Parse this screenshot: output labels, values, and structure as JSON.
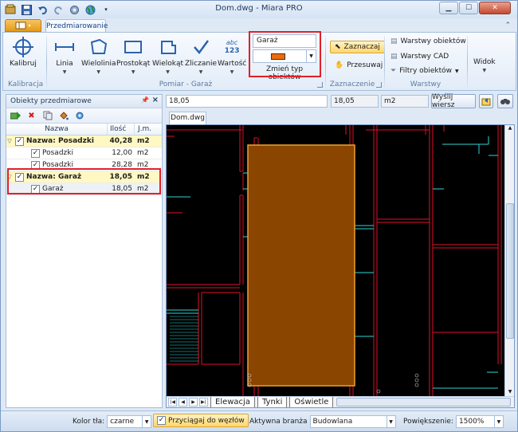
{
  "window": {
    "title": "Dom.dwg - Miara PRO",
    "controls": [
      "minimize",
      "maximize",
      "close"
    ]
  },
  "ribbon_tabs": {
    "active": "Przedmiarowanie"
  },
  "ribbon": {
    "kalibracja": {
      "button": "Kalibruj",
      "group": "Kalibracja"
    },
    "pomiar": {
      "buttons": [
        "Linia",
        "Wielolinia",
        "Prostokąt",
        "Wielokąt",
        "Zliczanie",
        "Wartość"
      ],
      "group": "Pomiar - Garaż",
      "value_icon_text": [
        "abc",
        "123"
      ]
    },
    "object_type": {
      "name": "Garaż",
      "color": "#f06a0c",
      "caption": "Zmień typ obiektów"
    },
    "zaznaczenie": {
      "select": "Zaznaczaj",
      "move": "Przesuwaj",
      "group": "Zaznaczenie"
    },
    "warstwy": {
      "items": [
        "Warstwy obiektów",
        "Warstwy CAD",
        "Filtry obiektów"
      ],
      "group": "Warstwy"
    },
    "widok": {
      "button": "Widok"
    }
  },
  "panel": {
    "title": "Obiekty przedmiarowe",
    "columns": [
      "Nazwa",
      "Ilość",
      "J.m."
    ],
    "groups": [
      {
        "name": "Nazwa: Posadzki",
        "qty": "40,28",
        "unit": "m2",
        "items": [
          {
            "name": "Posadzki",
            "qty": "12,00",
            "unit": "m2"
          },
          {
            "name": "Posadzki",
            "qty": "28,28",
            "unit": "m2"
          }
        ]
      },
      {
        "name": "Nazwa: Garaż",
        "qty": "18,05",
        "unit": "m2",
        "items": [
          {
            "name": "Garaż",
            "qty": "18,05",
            "unit": "m2"
          }
        ]
      }
    ]
  },
  "editbar": {
    "value": "18,05",
    "qty": "18,05",
    "unit": "m2",
    "send": "Wyślij wiersz"
  },
  "document": {
    "tab": "Dom.dwg",
    "sheets": [
      "Elewacja",
      "Tynki",
      "Oświetle"
    ]
  },
  "statusbar": {
    "bg_label": "Kolor tła:",
    "bg_value": "czarne",
    "snap": "Przyciągaj do węzłów",
    "branch_label": "Aktywna branża",
    "branch_value": "Budowlana",
    "zoom_label": "Powiększenie:",
    "zoom_value": "1500%"
  },
  "colors": {
    "accent_red": "#e0202a",
    "room_fill": "#8a4500",
    "room_outline": "#f0a030",
    "wall": "#e0102a",
    "cyan": "#30d6d6"
  }
}
